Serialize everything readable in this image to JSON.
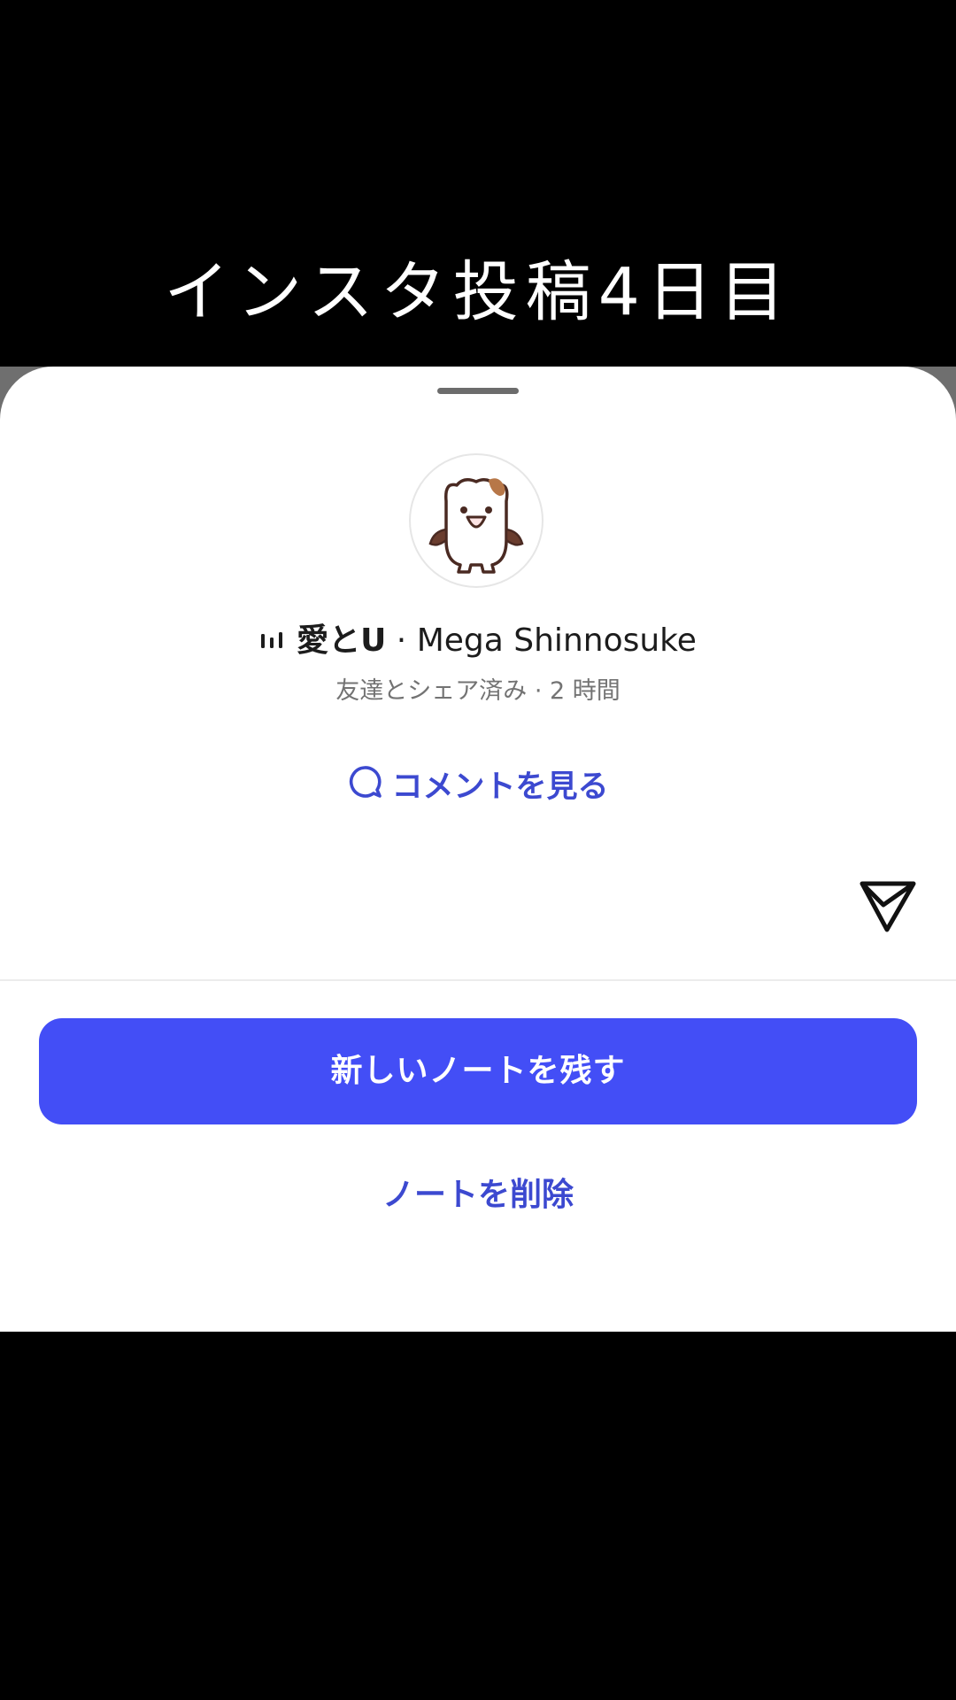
{
  "overlay": {
    "caption": "インスタ投稿4日目"
  },
  "note_sheet": {
    "song": {
      "title": "愛とU",
      "separator": "·",
      "artist": "Mega Shinnosuke"
    },
    "meta": {
      "shared_with": "友達とシェア済み",
      "separator": "·",
      "time_ago": "2 時間"
    },
    "comments_link_label": "コメントを見る",
    "primary_button_label": "新しいノートを残す",
    "delete_link_label": "ノートを削除"
  },
  "icons": {
    "music": "music-bars-icon",
    "comment": "comment-bubble-icon",
    "send": "send-icon",
    "avatar": "cat-avatar"
  },
  "colors": {
    "accent_blue": "#434ef6",
    "link_blue": "#3c49d0",
    "meta_gray": "#737373"
  }
}
